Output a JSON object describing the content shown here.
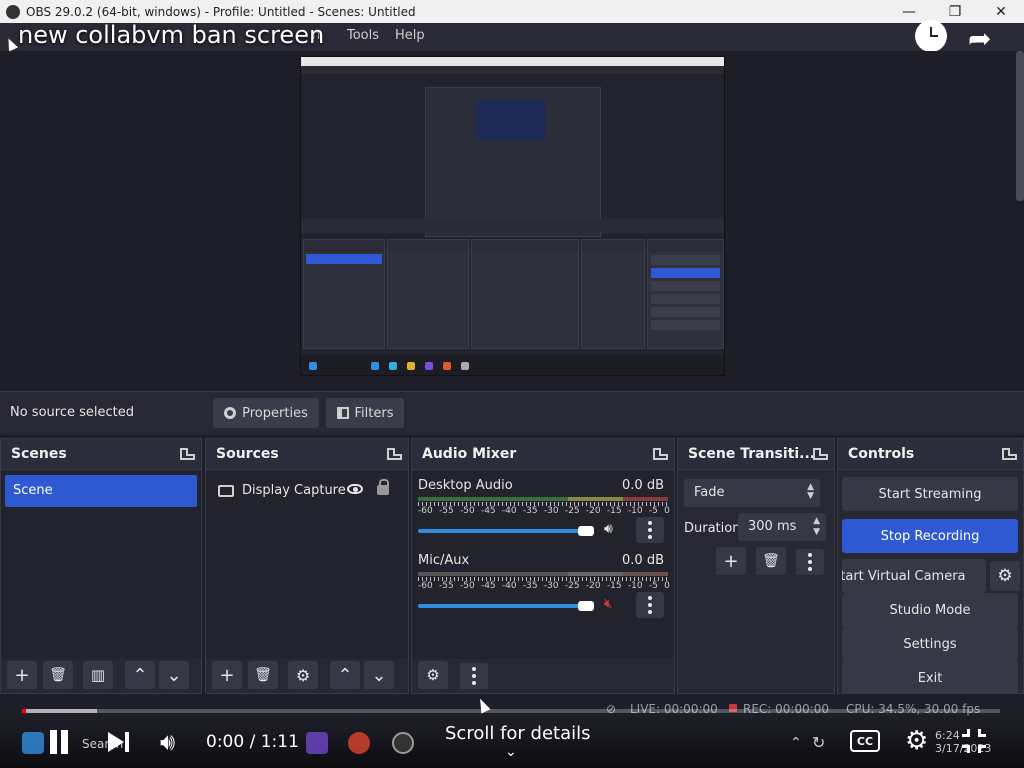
{
  "window": {
    "title": "OBS 29.0.2 (64-bit, windows) - Profile: Untitled - Scenes: Untitled",
    "minimize": "—",
    "restore": "❐",
    "close": "✕"
  },
  "overlay": {
    "video_title": "new collabvm ban screen"
  },
  "menu": {
    "items": [
      "n",
      "Tools",
      "Help"
    ]
  },
  "propbar": {
    "no_source": "No source selected",
    "properties_label": "Properties",
    "filters_label": "Filters"
  },
  "scenes": {
    "title": "Scenes",
    "items": [
      "Scene"
    ],
    "footer": [
      "+",
      "🗑",
      "▥",
      "⌃",
      "⌄"
    ]
  },
  "sources": {
    "title": "Sources",
    "items": [
      {
        "label": "Display Capture"
      }
    ],
    "footer": [
      "+",
      "🗑",
      "⚙",
      "⌃",
      "⌄"
    ]
  },
  "audio": {
    "title": "Audio Mixer",
    "scale": [
      "-60",
      "-55",
      "-50",
      "-45",
      "-40",
      "-35",
      "-30",
      "-25",
      "-20",
      "-15",
      "-10",
      "-5",
      "0"
    ],
    "channels": [
      {
        "name": "Desktop Audio",
        "db": "0.0 dB",
        "volume": 1.0,
        "muted": false
      },
      {
        "name": "Mic/Aux",
        "db": "0.0 dB",
        "volume": 1.0,
        "muted": true
      }
    ]
  },
  "transitions": {
    "title": "Scene Transiti...",
    "selected": "Fade",
    "duration_label": "Duration",
    "duration_value": "300 ms"
  },
  "controls": {
    "title": "Controls",
    "start_streaming": "Start Streaming",
    "stop_recording": "Stop Recording",
    "start_virtual_camera": "Start Virtual Camera",
    "studio_mode": "Studio Mode",
    "settings": "Settings",
    "exit": "Exit"
  },
  "status": {
    "live": "LIVE: 00:00:00",
    "rec": "REC: 00:00:00",
    "cpu": "CPU: 34.5%, 30.00 fps"
  },
  "player": {
    "current_time": "0:00",
    "separator": " / ",
    "duration": "1:11",
    "played_fraction": 0.0,
    "scroll_hint": "Scroll for details",
    "cc": "CC",
    "search_ghost": "Search",
    "clock_time": "6:24",
    "clock_date": "3/17/2023"
  },
  "colors": {
    "accent_blue": "#2f59d3",
    "progress_red": "#ff0000",
    "mute_red": "#d43a3a"
  }
}
